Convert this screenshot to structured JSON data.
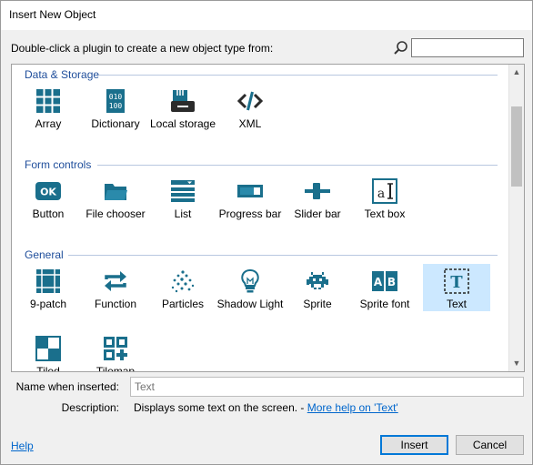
{
  "window": {
    "title": "Insert New Object"
  },
  "instruction": "Double-click a plugin to create a new object type from:",
  "search": {
    "placeholder": "",
    "value": ""
  },
  "groups": [
    {
      "title": "Data & Storage",
      "items": [
        "Array",
        "Dictionary",
        "Local storage",
        "XML"
      ]
    },
    {
      "title": "Form controls",
      "items": [
        "Button",
        "File chooser",
        "List",
        "Progress bar",
        "Slider bar",
        "Text box"
      ]
    },
    {
      "title": "General",
      "items": [
        "9-patch",
        "Function",
        "Particles",
        "Shadow Light",
        "Sprite",
        "Sprite font",
        "Text"
      ]
    },
    {
      "title": "",
      "items": [
        "Tiled",
        "Tilemap"
      ]
    }
  ],
  "selected_item": "Text",
  "name_field": {
    "label": "Name when inserted:",
    "value": "Text"
  },
  "description": {
    "label": "Description:",
    "text": "Displays some text on the screen. - ",
    "link": "More help on 'Text'"
  },
  "footer": {
    "help": "Help",
    "insert": "Insert",
    "cancel": "Cancel"
  },
  "colors": {
    "accent": "#0078d7",
    "group_title": "#1f4e9b",
    "selected_bg": "#cce8ff",
    "icon_teal": "#1a6f8c"
  }
}
